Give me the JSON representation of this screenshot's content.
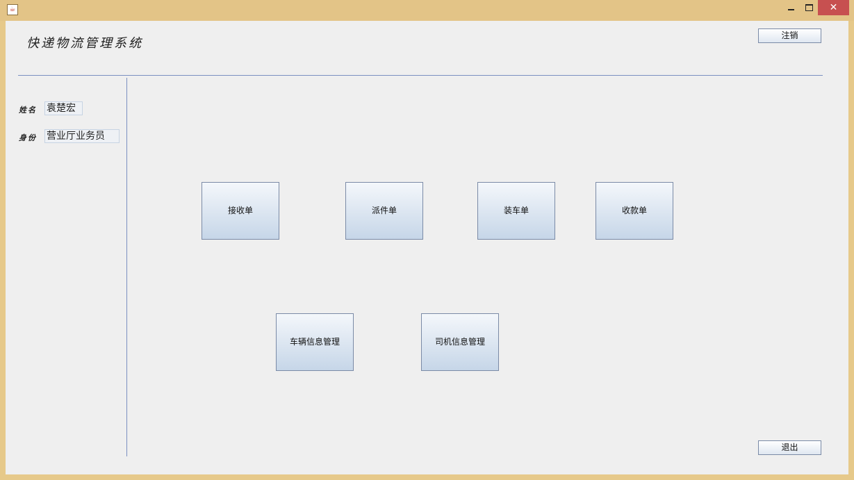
{
  "window": {
    "min_icon": "minimize-icon",
    "max_icon": "maximize-icon",
    "close_symbol": "✕",
    "app_icon": "java-cup-icon"
  },
  "header": {
    "title": "快递物流管理系统",
    "logout_label": "注销"
  },
  "sidebar": {
    "name_label": "姓名",
    "name_value": "袁楚宏",
    "role_label": "身份",
    "role_value": "营业厅业务员"
  },
  "functions": {
    "receive": "接收单",
    "dispatch": "派件单",
    "loading": "装车单",
    "payment": "收款单",
    "vehicle": "车辆信息管理",
    "driver": "司机信息管理"
  },
  "footer": {
    "exit_label": "退出"
  },
  "colors": {
    "frame": "#e3c487",
    "client_bg": "#efefef",
    "divider": "#7a8fc0",
    "close_bg": "#c75050"
  }
}
